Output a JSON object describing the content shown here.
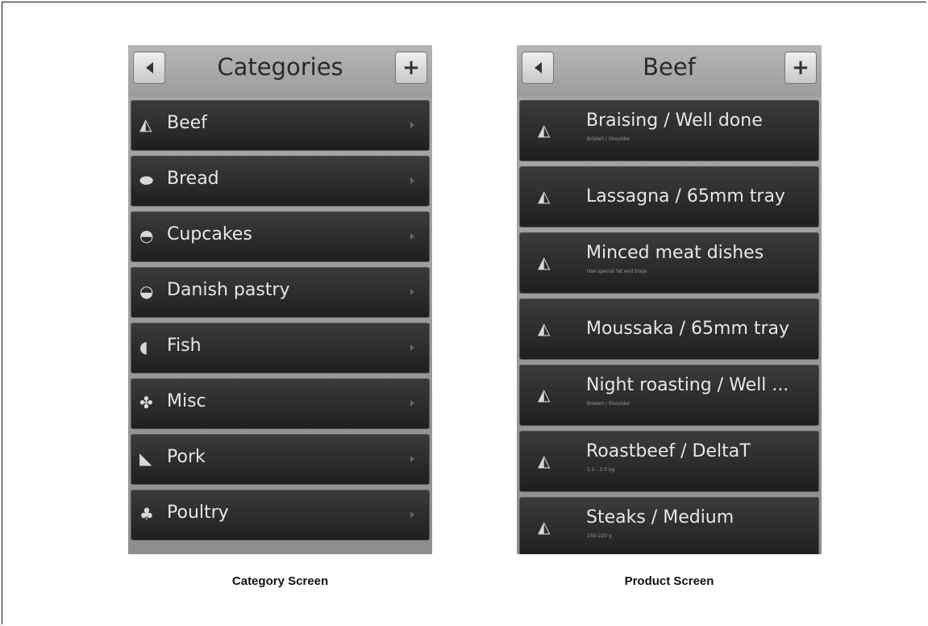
{
  "category_screen": {
    "title": "Categories",
    "back_icon": "back-arrow-icon",
    "add_label": "+",
    "items": [
      {
        "label": "Beef",
        "icon": "beef-icon"
      },
      {
        "label": "Bread",
        "icon": "bread-icon"
      },
      {
        "label": "Cupcakes",
        "icon": "cupcake-icon"
      },
      {
        "label": "Danish pastry",
        "icon": "pastry-icon"
      },
      {
        "label": "Fish",
        "icon": "fish-icon"
      },
      {
        "label": "Misc",
        "icon": "misc-icon"
      },
      {
        "label": "Pork",
        "icon": "pork-icon"
      },
      {
        "label": "Poultry",
        "icon": "poultry-icon"
      }
    ],
    "caption": "Category Screen"
  },
  "product_screen": {
    "title": "Beef",
    "add_label": "+",
    "items": [
      {
        "label": "Braising / Well done",
        "sub": "Brisket / Shoulder"
      },
      {
        "label": "Lassagna / 65mm tray",
        "sub": ""
      },
      {
        "label": "Minced meat dishes",
        "sub": "Use special fat and trays"
      },
      {
        "label": "Moussaka / 65mm tray",
        "sub": ""
      },
      {
        "label": "Night roasting / Well ...",
        "sub": "Brisket / Shoulder"
      },
      {
        "label": "Roastbeef / DeltaT",
        "sub": "1.5 - 3.0 kg"
      },
      {
        "label": "Steaks / Medium",
        "sub": "150-220 g"
      }
    ],
    "caption": "Product Screen"
  }
}
